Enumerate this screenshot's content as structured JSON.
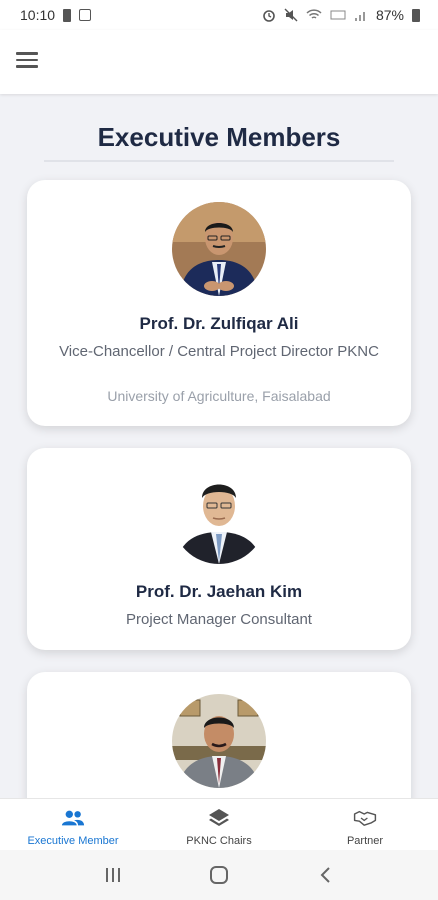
{
  "status_bar": {
    "time": "10:10",
    "battery": "87%"
  },
  "app_bar": {
    "menu_icon": "hamburger-menu-icon"
  },
  "page": {
    "title": "Executive Members"
  },
  "members": [
    {
      "name": "Prof. Dr. Zulfiqar Ali",
      "role": "Vice-Chancellor / Central Project Director PKNC",
      "organization": "University of Agriculture, Faisalabad"
    },
    {
      "name": "Prof. Dr. Jaehan Kim",
      "role": "Project Manager Consultant"
    },
    {
      "name": "",
      "role": ""
    }
  ],
  "bottom_nav": {
    "items": [
      {
        "label": "Executive Member",
        "icon": "people-icon",
        "active": true
      },
      {
        "label": "PKNC Chairs",
        "icon": "layers-icon",
        "active": false
      },
      {
        "label": "Partner",
        "icon": "handshake-icon",
        "active": false
      }
    ]
  },
  "colors": {
    "accent": "#1976d2",
    "title": "#1f2a44",
    "background": "#f1f2f6"
  }
}
